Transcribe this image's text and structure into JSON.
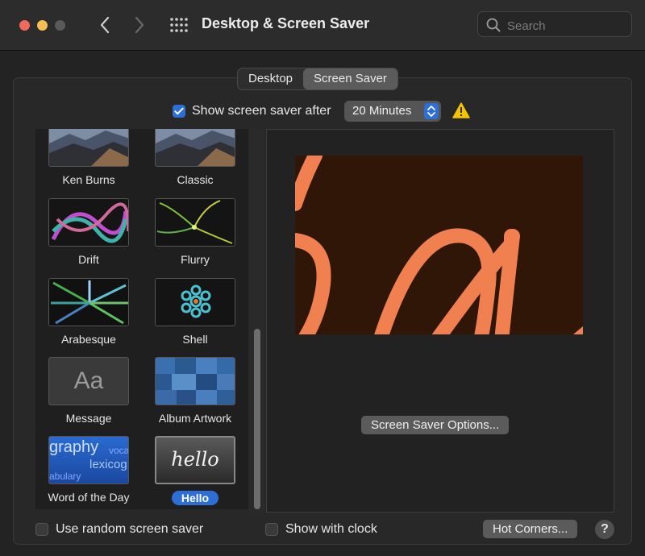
{
  "window": {
    "title": "Desktop & Screen Saver",
    "search_placeholder": "Search"
  },
  "tabs": [
    {
      "label": "Desktop",
      "selected": false
    },
    {
      "label": "Screen Saver",
      "selected": true
    }
  ],
  "show_after": {
    "label": "Show screen saver after",
    "checked": true,
    "value": "20 Minutes"
  },
  "savers": [
    {
      "label": "Ken Burns"
    },
    {
      "label": "Classic"
    },
    {
      "label": "Drift"
    },
    {
      "label": "Flurry"
    },
    {
      "label": "Arabesque"
    },
    {
      "label": "Shell"
    },
    {
      "label": "Message",
      "thumb_text": "Aa"
    },
    {
      "label": "Album Artwork"
    },
    {
      "label": "Word of the Day",
      "thumb_words": [
        "graphy",
        "voca",
        "lexicog",
        "abulary"
      ]
    },
    {
      "label": "Hello",
      "selected": true,
      "thumb_text": "hello"
    }
  ],
  "preview": {
    "options_button": "Screen Saver Options..."
  },
  "bottom": {
    "random_label": "Use random screen saver",
    "random_checked": false,
    "clock_label": "Show with clock",
    "clock_checked": false,
    "hot_corners_button": "Hot Corners...",
    "help_button": "?"
  },
  "colors": {
    "accent": "#2e6fd6",
    "warning": "#f5c400",
    "preview_bg": "#2f1607",
    "preview_stroke": "#f0804f"
  }
}
